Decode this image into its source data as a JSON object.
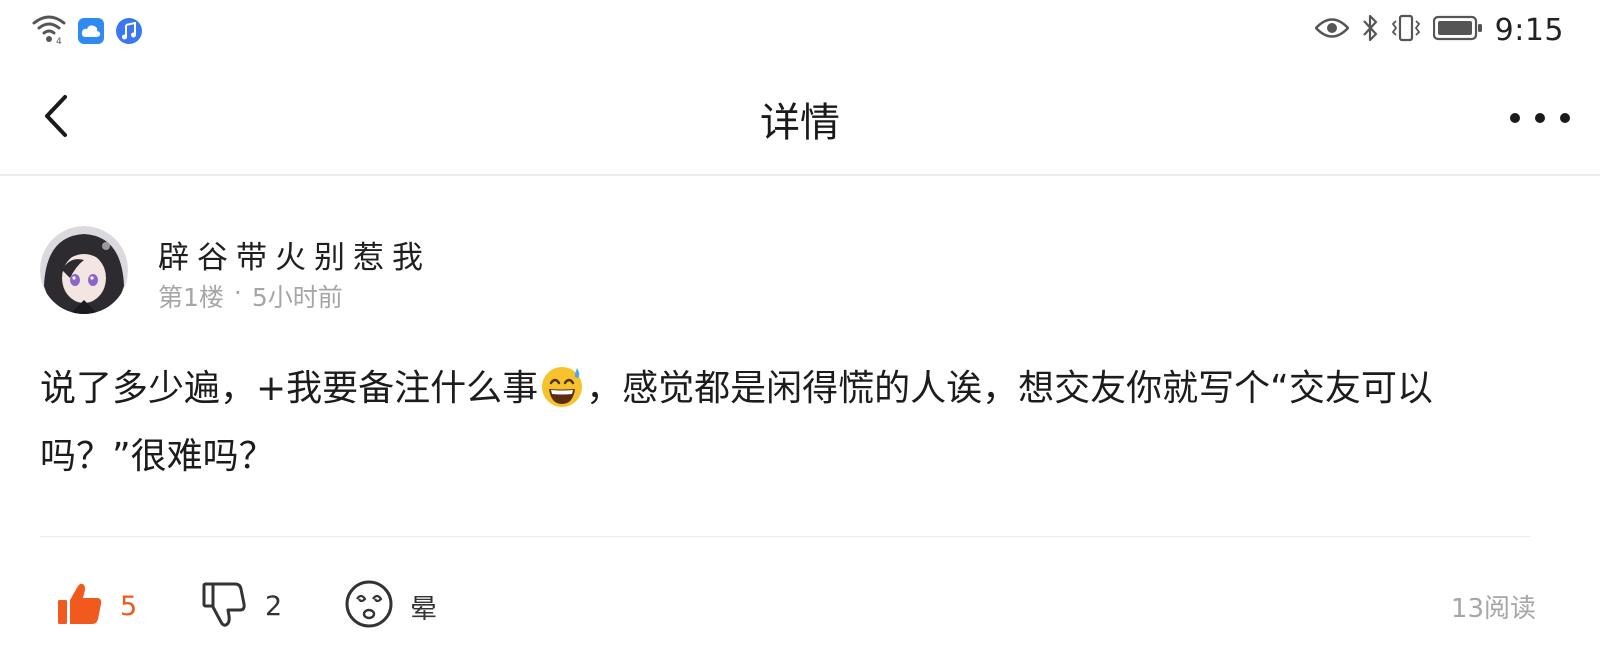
{
  "status_bar": {
    "time": "9:15",
    "left_icons": [
      "wifi-icon",
      "cloud-icon",
      "music-icon"
    ],
    "right_icons": [
      "eye-icon",
      "bluetooth-icon",
      "vibrate-icon",
      "battery-icon"
    ]
  },
  "nav": {
    "title": "详情",
    "back_icon": "chevron-left-icon",
    "more_icon": "more-dots-icon"
  },
  "post": {
    "username": "辟谷带火别惹我",
    "floor": "第1楼",
    "separator": "·",
    "time_ago": "5小时前",
    "body_part1": "说了多少遍，+我要备注什么事",
    "body_emoji": "sweat-smile-emoji",
    "body_part2": "，感觉都是闲得慌的人诶，想交友你就写个“交友可以吗？”很难吗？"
  },
  "actions": {
    "like_count": "5",
    "dislike_count": "2",
    "dizzy_label": "晕",
    "read_count": "13阅读"
  },
  "colors": {
    "accent": "#f05a1f",
    "meta_gray": "#a6a6a6",
    "divider": "#ececec"
  }
}
